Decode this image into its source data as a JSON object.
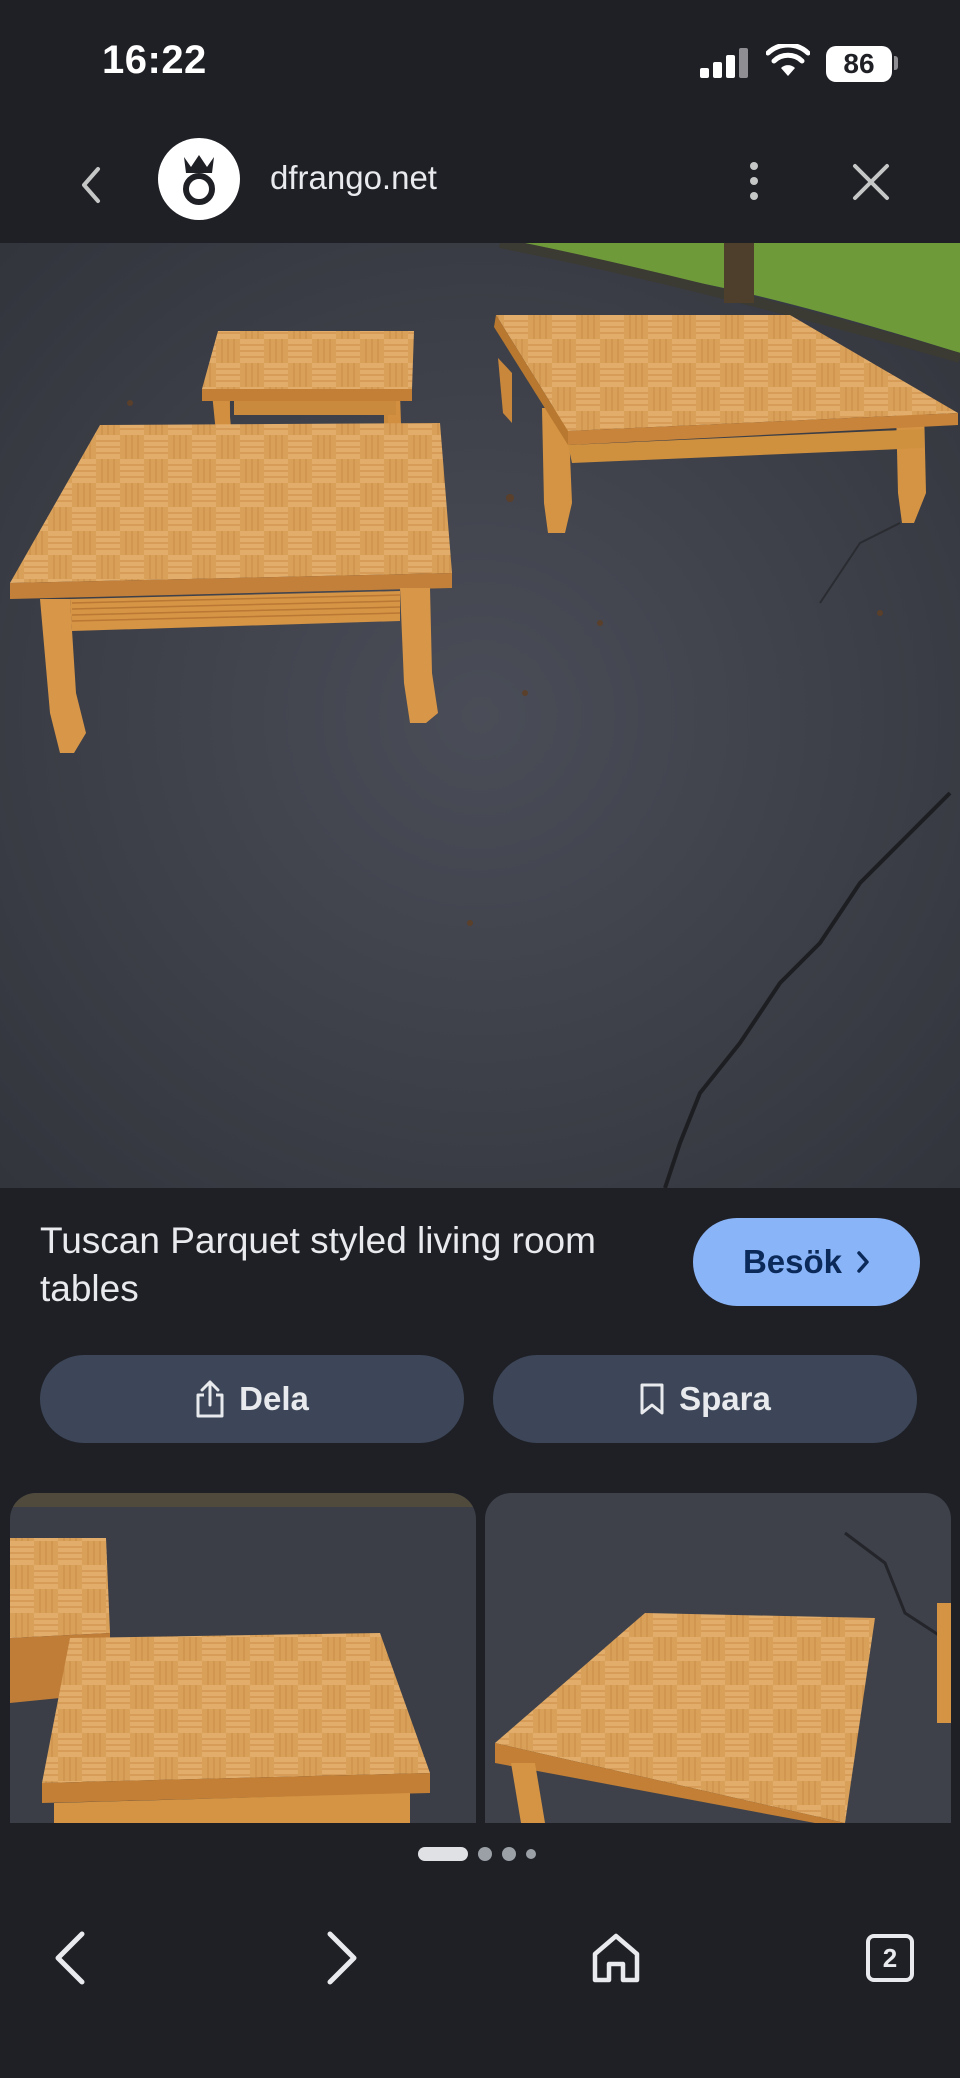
{
  "status_bar": {
    "time": "16:22",
    "battery": "86"
  },
  "header": {
    "site_name": "dfrango.net",
    "icons": [
      "chevron-left-icon",
      "site-logo-icon",
      "more-vert-icon",
      "close-icon"
    ]
  },
  "result": {
    "title": "Tuscan Parquet styled living room tables",
    "visit_label": "Besök",
    "share_label": "Dela",
    "save_label": "Spara"
  },
  "thumbnails": {
    "count_visible": 2,
    "page_dots": 4,
    "active_dot": 0
  },
  "bottom_nav": {
    "tab_count": "2",
    "icons": [
      "back-arrow-icon",
      "forward-arrow-icon",
      "home-icon",
      "tabs-icon"
    ]
  },
  "colors": {
    "background": "#1f2026",
    "accent_button": "#8ab4f8",
    "secondary_button": "#3c4658",
    "wood": "#d99a4e",
    "asphalt": "#3a3d46",
    "grass": "#6e9a3a"
  }
}
